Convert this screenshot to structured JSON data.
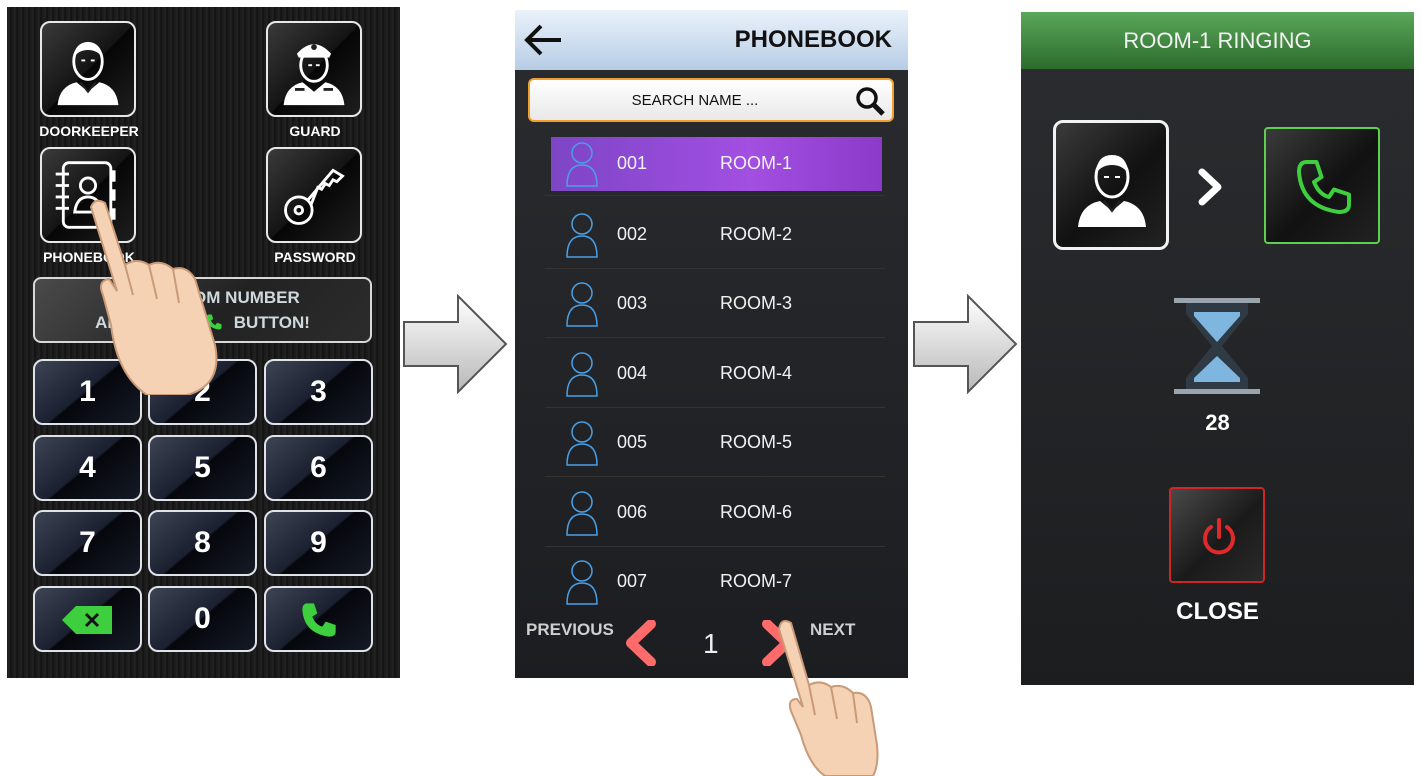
{
  "keypad_screen": {
    "tiles": [
      {
        "label": "DOORKEEPER",
        "icon": "doorkeeper-icon"
      },
      {
        "label": "GUARD",
        "icon": "guard-icon"
      },
      {
        "label": "PHONEBOOK",
        "icon": "phonebook-icon"
      },
      {
        "label": "PASSWORD",
        "icon": "key-icon"
      }
    ],
    "instruction_line1": "ENTER ROOM NUMBER",
    "instruction_line2": "AND PRESS",
    "instruction_line2_end": "BUTTON!",
    "keys": [
      "1",
      "2",
      "3",
      "4",
      "5",
      "6",
      "7",
      "8",
      "9",
      "0"
    ],
    "delete_icon": "backspace-icon",
    "call_icon": "phone-icon",
    "accent_green": "#3ecf3e"
  },
  "phonebook_screen": {
    "title": "PHONEBOOK",
    "search_placeholder": "SEARCH NAME ...",
    "entries": [
      {
        "number": "001",
        "name": "ROOM-1",
        "selected": true
      },
      {
        "number": "002",
        "name": "ROOM-2",
        "selected": false
      },
      {
        "number": "003",
        "name": "ROOM-3",
        "selected": false
      },
      {
        "number": "004",
        "name": "ROOM-4",
        "selected": false
      },
      {
        "number": "005",
        "name": "ROOM-5",
        "selected": false
      },
      {
        "number": "006",
        "name": "ROOM-6",
        "selected": false
      },
      {
        "number": "007",
        "name": "ROOM-7",
        "selected": false
      }
    ],
    "previous_label": "PREVIOUS",
    "next_label": "NEXT",
    "page": "1",
    "selected_color": "#9b4fe0",
    "pager_arrow_color": "#ff6b6b"
  },
  "ringing_screen": {
    "title": "ROOM-1 RINGING",
    "countdown": "28",
    "close_label": "CLOSE",
    "header_color": "#3d8a3d",
    "close_color": "#d02525"
  }
}
